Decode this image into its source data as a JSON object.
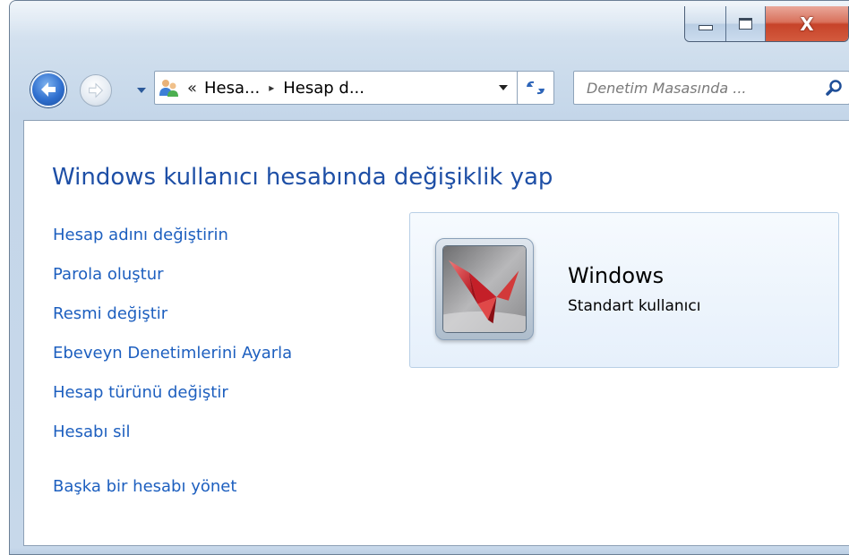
{
  "window": {
    "caption": {
      "minimize_icon": "minimize-icon",
      "maximize_icon": "maximize-icon",
      "close_label": "X"
    }
  },
  "nav": {
    "back_icon": "back-arrow-icon",
    "forward_icon": "forward-arrow-icon",
    "history_icon": "chevron-down-icon"
  },
  "address_bar": {
    "icon": "user-accounts-icon",
    "overflow_chevron": "«",
    "breadcrumbs": [
      "Hesa...",
      "Hesap d..."
    ],
    "separator": "▸",
    "dropdown_icon": "chevron-down-icon",
    "refresh_icon": "refresh-icon"
  },
  "search": {
    "placeholder": "Denetim Masasında ...",
    "icon": "search-icon"
  },
  "page": {
    "title": "Windows kullanıcı hesabında değişiklik yap",
    "tasks": [
      "Hesap adını değiştirin",
      "Parola oluştur",
      "Resmi değiştir",
      "Ebeveyn Denetimlerini Ayarla",
      "Hesap türünü değiştir",
      "Hesabı sil"
    ],
    "manage_other": "Başka bir hesabı yönet"
  },
  "user": {
    "name": "Windows",
    "type": "Standart kullanıcı",
    "picture": "origami-crane-picture"
  },
  "colors": {
    "link": "#1d5fbf",
    "title": "#1e4fa6",
    "close_button": "#c7432a",
    "card_background": "#e6f0fb"
  }
}
